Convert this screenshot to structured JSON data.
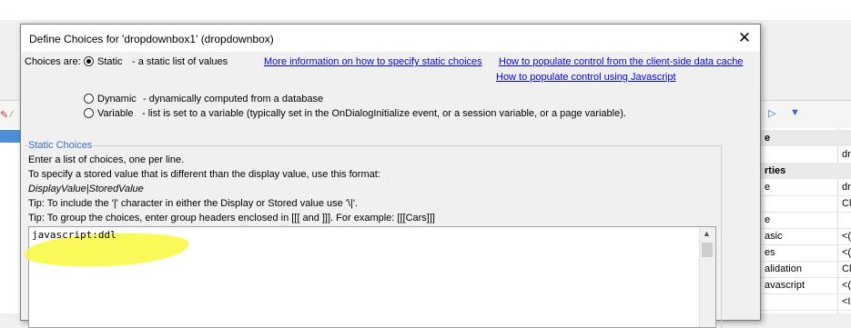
{
  "dialog": {
    "title": "Define Choices for 'dropdownbox1' (dropdownbox)",
    "choices_are_label": "Choices are:",
    "options": [
      {
        "label": "Static",
        "desc": "- a static list of values",
        "selected": true
      },
      {
        "label": "Dynamic",
        "desc": "- dynamically computed from a database",
        "selected": false
      },
      {
        "label": "Variable",
        "desc": "- list is set to a variable (typically set in the OnDialogInitialize event, or a session variable, or a page variable).",
        "selected": false
      }
    ],
    "links": {
      "more_info": "More information on how to specify static choices",
      "client_cache": "How to populate control from the client-side data cache",
      "javascript": "How to populate control using Javascript"
    },
    "static_choices": {
      "title": "Static Choices",
      "line1": "Enter a list of choices, one per line.",
      "line2": "To specify a stored value that is different than the display value, use this format:",
      "format": "DisplayValue|StoredValue",
      "tip1": "Tip: To include the '|' character in either the Display or Stored value use '\\|'.",
      "tip2": "Tip: To group the choices, enter group headers enclosed in [[[ and ]]]. For example: [[[Cars]]]",
      "value": "javascript:ddl"
    },
    "highlight_color": "#f8f83c"
  },
  "background": {
    "properties": [
      {
        "name": "e",
        "value": "",
        "category": true
      },
      {
        "name": "",
        "value": "dr",
        "category": false
      },
      {
        "name": "rties",
        "value": "",
        "category": true
      },
      {
        "name": "e",
        "value": "dr",
        "category": false
      },
      {
        "name": "",
        "value": "Ch",
        "category": false
      },
      {
        "name": "e",
        "value": "",
        "category": false
      },
      {
        "name": "asic",
        "value": "<(",
        "category": false
      },
      {
        "name": "es",
        "value": "<(",
        "category": false
      },
      {
        "name": "alidation",
        "value": "Cli",
        "category": false
      },
      {
        "name": "avascript",
        "value": "<(",
        "category": false
      },
      {
        "name": "",
        "value": "<I",
        "category": false
      }
    ],
    "accent_color": "#3a5fcd"
  }
}
